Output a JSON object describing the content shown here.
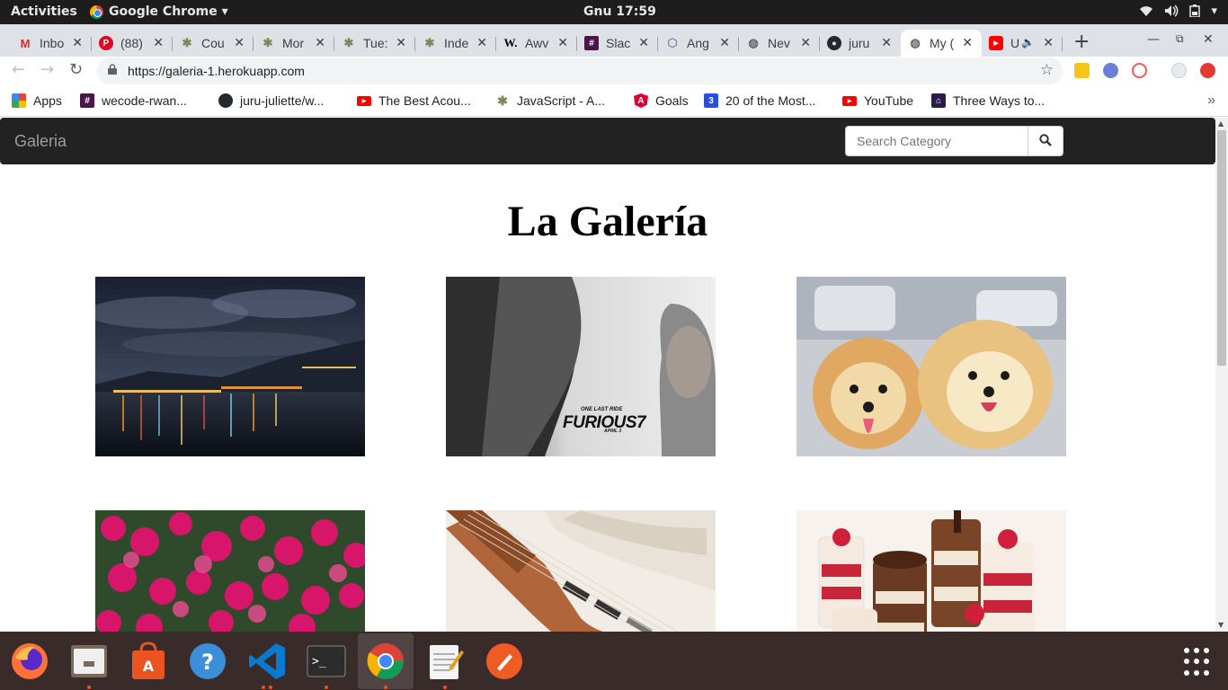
{
  "system_bar": {
    "activities": "Activities",
    "app_menu": "Google Chrome ▾",
    "clock": "Gnu 17:59"
  },
  "tabs": [
    {
      "title": "Inbo",
      "icon": "gmail-icon"
    },
    {
      "title": "(88)",
      "icon": "pinterest-icon"
    },
    {
      "title": "Cou",
      "icon": "palm-icon"
    },
    {
      "title": "Mor",
      "icon": "palm-icon"
    },
    {
      "title": "Tue:",
      "icon": "palm-icon"
    },
    {
      "title": "Inde",
      "icon": "palm-icon"
    },
    {
      "title": "Awv",
      "icon": "w-icon"
    },
    {
      "title": "Slac",
      "icon": "slack-icon"
    },
    {
      "title": "Ang",
      "icon": "angular-icon"
    },
    {
      "title": "Nev",
      "icon": "globe-icon"
    },
    {
      "title": "juru",
      "icon": "github-icon"
    },
    {
      "title": "My (",
      "icon": "globe-icon"
    },
    {
      "title": "U",
      "icon": "youtube-icon"
    }
  ],
  "address_bar": {
    "url": "https://galeria-1.herokuapp.com"
  },
  "bookmarks": [
    {
      "label": "Apps",
      "icon": "apps-grid-icon"
    },
    {
      "label": "wecode-rwan...",
      "icon": "slack-icon"
    },
    {
      "label": "juru-juliette/w...",
      "icon": "github-icon"
    },
    {
      "label": "The Best Acou...",
      "icon": "youtube-icon"
    },
    {
      "label": "JavaScript - A...",
      "icon": "palm-icon"
    },
    {
      "label": "Goals",
      "icon": "angular-icon"
    },
    {
      "label": "20 of the Most...",
      "icon": "css3-icon"
    },
    {
      "label": "YouTube",
      "icon": "youtube-icon"
    },
    {
      "label": "Three Ways to...",
      "icon": "bookmark-icon"
    }
  ],
  "page": {
    "brand": "Galeria",
    "search_placeholder": "Search Category",
    "heading": "La Galería",
    "poster_tagline": "ONE LAST RIDE",
    "poster_title": "FURIOUS7",
    "poster_date": "APRIL 3"
  },
  "colors": {
    "navbar": "#222222",
    "tab_strip": "#dee1e6",
    "dock": "#3a2b2b",
    "accent_dot": "#e95420"
  }
}
